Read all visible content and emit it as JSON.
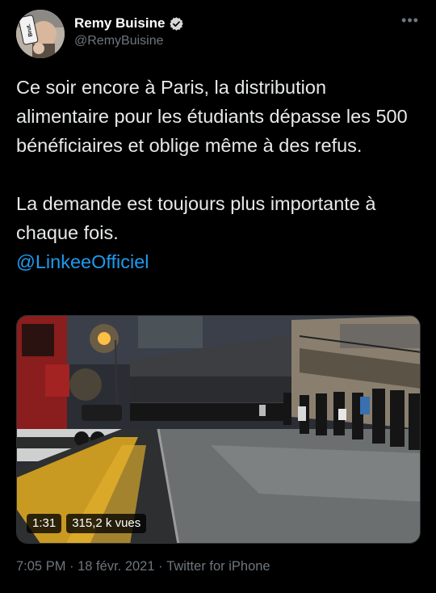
{
  "author": {
    "display_name": "Remy Buisine",
    "handle": "@RemyBuisine",
    "avatar_mark": "Brut."
  },
  "tweet": {
    "paragraph_1": "Ce soir encore à Paris, la distribution alimentaire pour les étudiants dépasse les 500 bénéficiaires et oblige même à des refus.",
    "paragraph_2": "La demande est toujours plus importante à chaque fois.",
    "mention": "@LinkeeOfficiel"
  },
  "video": {
    "duration": "1:31",
    "views": "315,2 k vues"
  },
  "footer": {
    "time": "7:05 PM",
    "separator_1": " · ",
    "date": "18 févr. 2021",
    "separator_2": " · ",
    "source": "Twitter for iPhone"
  },
  "icons": {
    "verified": "verified-badge-icon",
    "more": "more-options-icon"
  },
  "colors": {
    "background": "#000000",
    "link": "#1d9bf0",
    "secondary_text": "#6e767d",
    "primary_text": "#e7e9ea"
  }
}
